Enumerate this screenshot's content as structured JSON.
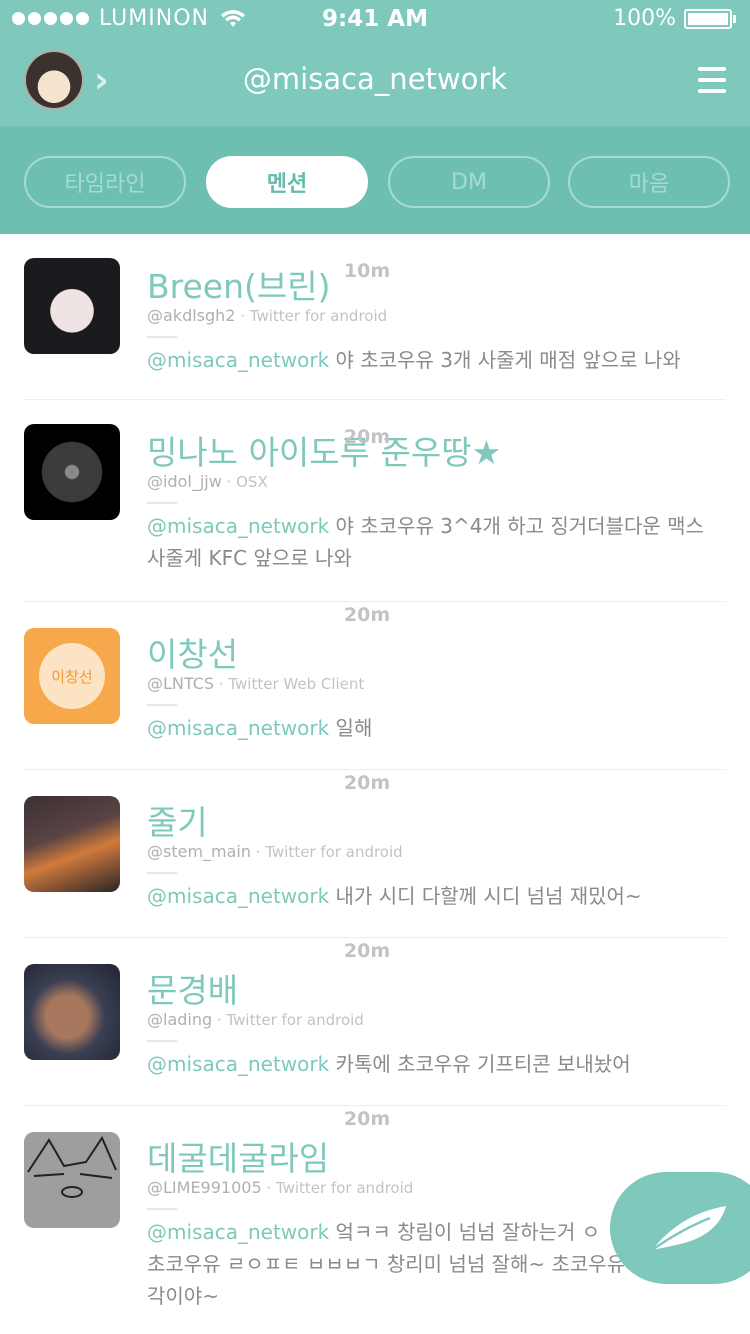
{
  "status": {
    "carrier": "LUMINON",
    "time": "9:41 AM",
    "battery": "100%"
  },
  "header": {
    "title": "@misaca_network"
  },
  "tabs": [
    "타임라인",
    "멘션",
    "DM",
    "마음"
  ],
  "active_tab": "멘션",
  "tweets": [
    {
      "name": "Breen(브린)",
      "handle": "@akdlsgh2",
      "client": " · Twitter for android",
      "mention": "@misaca_network",
      "text": " 야 초코우유 3개 사줄게 매점 앞으로 나와",
      "time": "10m"
    },
    {
      "name": "밍나노 아이도루 준우땅★",
      "handle": "@idol_jjw",
      "client": " · OSX",
      "mention": "@misaca_network",
      "text": " 야 초코우유 3^4개 하고 징거더블다운 맥스 사줄게 KFC 앞으로 나와",
      "time": "20m"
    },
    {
      "name": "이창선",
      "handle": "@LNTCS",
      "client": " · Twitter Web Client",
      "mention": "@misaca_network",
      "text": " 일해",
      "time": "20m",
      "avatar_text": "이창선"
    },
    {
      "name": "줄기",
      "handle": "@stem_main",
      "client": " · Twitter for android",
      "mention": "@misaca_network",
      "text": " 내가 시디 다할께 시디 넘넘 재밌어~",
      "time": "20m"
    },
    {
      "name": "문경배",
      "handle": "@lading",
      "client": " · Twitter for android",
      "mention": "@misaca_network",
      "text": " 카톡에 초코우유 기프티콘 보내놨어",
      "time": "20m"
    },
    {
      "name": "데굴데굴라임",
      "handle": "@LIME991005",
      "client": " · Twitter for android",
      "mention": "@misaca_network",
      "text": " 엌ㅋㅋ 창림이 넘넘 잘하는거 ㅇ ㅇㅈ 반박시 초코우유 ㄹㅇㅍㅌ ㅂㅂㅂㄱ 창리미 넘넘 잘해~ 초코우유 사줘야할 각이야~",
      "time": "20m"
    }
  ],
  "icons": {
    "signal": "signal-dots-icon",
    "wifi": "wifi-icon",
    "battery": "battery-icon",
    "menu": "hamburger-icon",
    "chevron": "chevron-right-icon",
    "compose": "feather-icon"
  },
  "colors": {
    "accent": "#7ec8bc",
    "tabbar": "#6dbfb2",
    "active_tab_text": "#65bcae"
  }
}
